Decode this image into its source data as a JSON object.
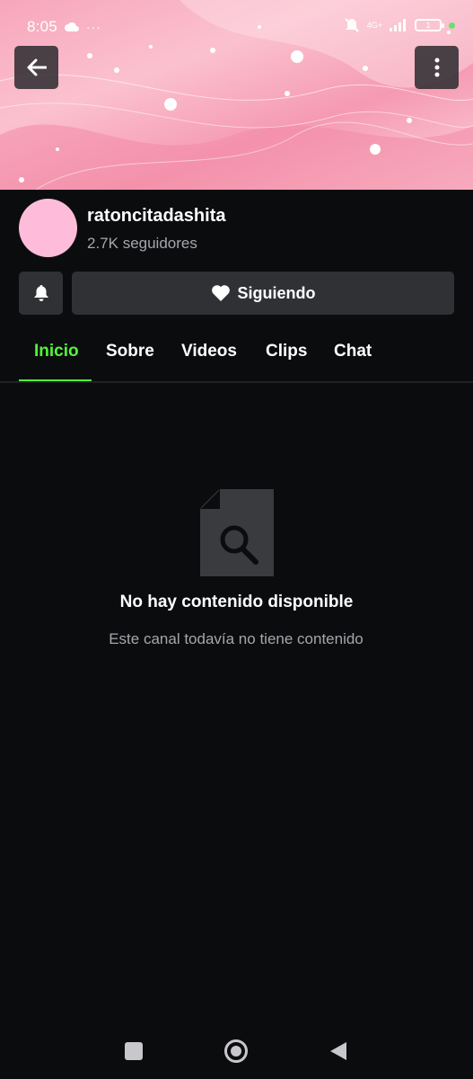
{
  "status_bar": {
    "time": "8:05",
    "network_label": "4G+",
    "battery_level": "1",
    "icons": [
      "cloud-icon",
      "more-dots-icon",
      "mute-icon",
      "signal-icon",
      "battery-icon",
      "dot-icon"
    ]
  },
  "header": {
    "back_icon": "arrow-left-icon",
    "more_icon": "vertical-dots-icon"
  },
  "channel": {
    "name": "ratoncitadashita",
    "followers": "2.7K seguidores",
    "avatar_color": "#ffbcda"
  },
  "actions": {
    "notify_icon": "bell-icon",
    "follow_label": "Siguiendo",
    "follow_icon": "heart-icon"
  },
  "tabs": [
    {
      "label": "Inicio",
      "active": true
    },
    {
      "label": "Sobre",
      "active": false
    },
    {
      "label": "Videos",
      "active": false
    },
    {
      "label": "Clips",
      "active": false
    },
    {
      "label": "Chat",
      "active": false
    }
  ],
  "empty_state": {
    "icon": "file-search-icon",
    "title": "No hay contenido disponible",
    "description": "Este canal todavía no tiene contenido"
  },
  "navigation_bar": {
    "items": [
      "recents-square-icon",
      "home-circle-icon",
      "back-triangle-icon"
    ]
  },
  "colors": {
    "accent": "#53f53a",
    "background": "#0b0c0e",
    "button_bg": "#2f3135",
    "muted_text": "#a6a6ad"
  }
}
